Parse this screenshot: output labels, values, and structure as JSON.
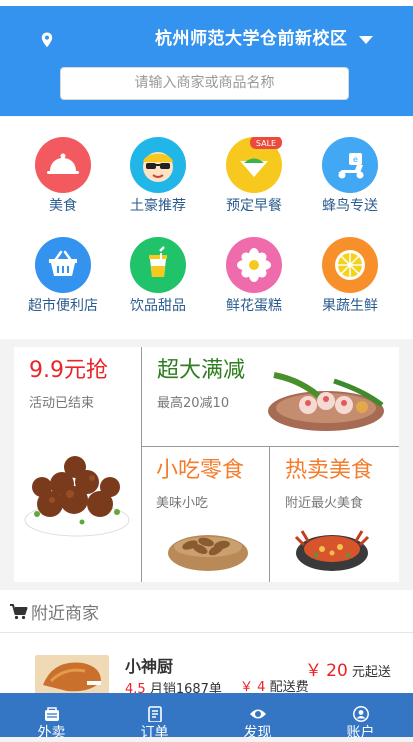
{
  "header": {
    "location": "杭州师范大学仓前新校区",
    "search_placeholder": "请输入商家或商品名称"
  },
  "categories": [
    {
      "label": "美食",
      "icon": "food-cloche-icon",
      "color": "#f25a5f"
    },
    {
      "label": "土豪推荐",
      "icon": "sunglasses-face-icon",
      "color": "#20b6e8"
    },
    {
      "label": "预定早餐",
      "icon": "breakfast-sale-icon",
      "color": "#f7c81d"
    },
    {
      "label": "蜂鸟专送",
      "icon": "delivery-scooter-icon",
      "color": "#42a8f3"
    },
    {
      "label": "超市便利店",
      "icon": "shopping-basket-icon",
      "color": "#3393ee"
    },
    {
      "label": "饮品甜品",
      "icon": "drink-cup-icon",
      "color": "#20c26a"
    },
    {
      "label": "鲜花蛋糕",
      "icon": "flower-icon",
      "color": "#f06bab"
    },
    {
      "label": "果蔬生鲜",
      "icon": "fruit-slice-icon",
      "color": "#f7902a"
    }
  ],
  "promos": {
    "flash": {
      "title": "9.9元抢",
      "subtitle": "活动已结束",
      "color": "#e8262a"
    },
    "discount": {
      "title": "超大满减",
      "subtitle": "最高20减10",
      "color": "#2f7d1e"
    },
    "snacks": {
      "title": "小吃零食",
      "subtitle": "美味小吃",
      "color": "#f47c2c"
    },
    "hot": {
      "title": "热卖美食",
      "subtitle": "附近最火美食",
      "color": "#f47c2c"
    }
  },
  "nearby": {
    "title": "附近商家"
  },
  "shops": [
    {
      "name": "小神厨",
      "rating": "4.5",
      "sales": "月销1687单",
      "fee_symbol": "￥",
      "fee": "4",
      "fee_label": "配送费",
      "min_symbol": "￥",
      "min": "20",
      "min_label": "元起送"
    }
  ],
  "tabs": [
    {
      "label": "外卖",
      "icon": "takeout-icon"
    },
    {
      "label": "订单",
      "icon": "order-list-icon"
    },
    {
      "label": "发现",
      "icon": "eye-icon"
    },
    {
      "label": "账户",
      "icon": "user-icon"
    }
  ]
}
